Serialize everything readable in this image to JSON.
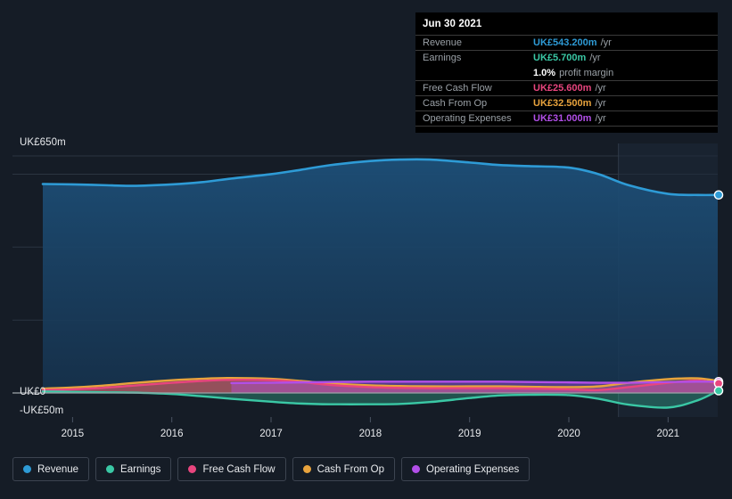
{
  "tooltip": {
    "date": "Jun 30 2021",
    "rows": [
      {
        "label": "Revenue",
        "value": "UK£543.200m",
        "unit": "/yr",
        "color": "#2e9bd6"
      },
      {
        "label": "Earnings",
        "value": "UK£5.700m",
        "unit": "/yr",
        "color": "#3ac8a5"
      },
      {
        "label": "",
        "value": "1.0%",
        "unit": "profit margin",
        "color": "#ffffff",
        "sub": true
      },
      {
        "label": "Free Cash Flow",
        "value": "UK£25.600m",
        "unit": "/yr",
        "color": "#e8457e"
      },
      {
        "label": "Cash From Op",
        "value": "UK£32.500m",
        "unit": "/yr",
        "color": "#e8a33d"
      },
      {
        "label": "Operating Expenses",
        "value": "UK£31.000m",
        "unit": "/yr",
        "color": "#b24fe8"
      }
    ]
  },
  "axes": {
    "y_top_label": "UK£650m",
    "y_zero_label": "UK£0",
    "y_negative_label": "-UK£50m",
    "x_labels": [
      "2015",
      "2016",
      "2017",
      "2018",
      "2019",
      "2020",
      "2021"
    ]
  },
  "legend": {
    "items": [
      {
        "label": "Revenue",
        "color": "#2e9bd6"
      },
      {
        "label": "Earnings",
        "color": "#3ac8a5"
      },
      {
        "label": "Free Cash Flow",
        "color": "#e8457e"
      },
      {
        "label": "Cash From Op",
        "color": "#e8a33d"
      },
      {
        "label": "Operating Expenses",
        "color": "#b24fe8"
      }
    ]
  },
  "colors": {
    "background": "#151c26",
    "tooltip_background": "#000000",
    "gridline": "#2b3440",
    "zero_line": "#9aa0a6",
    "forecast_band": "#1d2938"
  },
  "chart_data": {
    "type": "area",
    "title": "",
    "xlabel": "",
    "ylabel": "UK£",
    "ylim": [
      -50,
      650
    ],
    "grid": true,
    "legend_position": "bottom",
    "x": [
      2014.7,
      2015.0,
      2015.3,
      2015.6,
      2016.0,
      2016.3,
      2016.6,
      2017.0,
      2017.3,
      2017.6,
      2018.0,
      2018.3,
      2018.6,
      2019.0,
      2019.3,
      2019.6,
      2020.0,
      2020.3,
      2020.6,
      2021.0,
      2021.3,
      2021.5
    ],
    "x_axis_ticks": [
      2015,
      2016,
      2017,
      2018,
      2019,
      2020,
      2021
    ],
    "forecast_start": 2020.5,
    "series": [
      {
        "name": "Revenue",
        "color": "#2e9bd6",
        "values": [
          573,
          572,
          570,
          568,
          572,
          578,
          588,
          600,
          612,
          625,
          636,
          640,
          640,
          632,
          625,
          622,
          618,
          600,
          570,
          546,
          543,
          543
        ]
      },
      {
        "name": "Earnings",
        "color": "#3ac8a5",
        "values": [
          4,
          3,
          2,
          1,
          -3,
          -9,
          -16,
          -24,
          -29,
          -31,
          -31,
          -30,
          -25,
          -14,
          -7,
          -5,
          -6,
          -16,
          -32,
          -40,
          -20,
          6
        ]
      },
      {
        "name": "Free Cash Flow",
        "color": "#e8457e",
        "values": [
          8,
          10,
          14,
          20,
          28,
          33,
          36,
          35,
          30,
          22,
          16,
          14,
          13,
          13,
          13,
          12,
          10,
          8,
          16,
          28,
          34,
          26
        ]
      },
      {
        "name": "Cash From Op",
        "color": "#e8a33d",
        "values": [
          12,
          15,
          20,
          27,
          35,
          39,
          41,
          39,
          33,
          26,
          21,
          19,
          18,
          18,
          18,
          17,
          16,
          18,
          28,
          38,
          40,
          33
        ]
      },
      {
        "name": "Operating Expenses",
        "color": "#b24fe8",
        "values": [
          null,
          null,
          null,
          null,
          null,
          null,
          27,
          28,
          29,
          30,
          31,
          31,
          31,
          31,
          31,
          30,
          29,
          28,
          28,
          30,
          31,
          31
        ]
      }
    ],
    "end_markers": [
      {
        "name": "Revenue",
        "value": 543,
        "color": "#2e9bd6"
      },
      {
        "name": "Operating Expenses",
        "value": 31,
        "color": "#b24fe8"
      },
      {
        "name": "Free Cash Flow",
        "value": 26,
        "color": "#e8457e"
      },
      {
        "name": "Earnings",
        "value": 6,
        "color": "#3ac8a5"
      }
    ],
    "gridlines_y": [
      650,
      600,
      400,
      200,
      0
    ]
  }
}
